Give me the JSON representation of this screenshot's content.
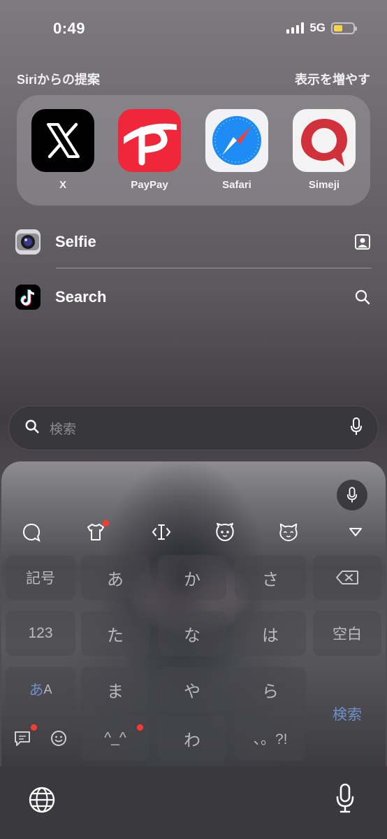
{
  "status_bar": {
    "time": "0:49",
    "network": "5G",
    "battery_color": "#f5d547"
  },
  "siri": {
    "title": "Siriからの提案",
    "show_more": "表示を増やす",
    "apps": [
      {
        "label": "X",
        "icon": "x-app-icon"
      },
      {
        "label": "PayPay",
        "icon": "paypay-app-icon"
      },
      {
        "label": "Safari",
        "icon": "safari-app-icon"
      },
      {
        "label": "Simeji",
        "icon": "simeji-app-icon"
      }
    ]
  },
  "shortcuts": [
    {
      "label": "Selfie",
      "icon": "camera-app-icon",
      "end_icon": "contact-card-icon"
    },
    {
      "label": "Search",
      "icon": "tiktok-app-icon",
      "end_icon": "search-icon"
    }
  ],
  "search": {
    "placeholder": "検索"
  },
  "keyboard": {
    "keys": {
      "symbol": "記号",
      "a": "あ",
      "ka": "か",
      "sa": "さ",
      "num": "123",
      "ta": "た",
      "na": "な",
      "ha": "は",
      "space": "空白",
      "kana_a": "あ",
      "kana_A": "A",
      "ma": "ま",
      "ya": "や",
      "ra": "ら",
      "search": "検索",
      "emoticon": "^_^",
      "wa": "わ",
      "punct": "、。?!"
    },
    "accent_color": "#ff3b30",
    "search_key_color": "#6f8fc8"
  }
}
